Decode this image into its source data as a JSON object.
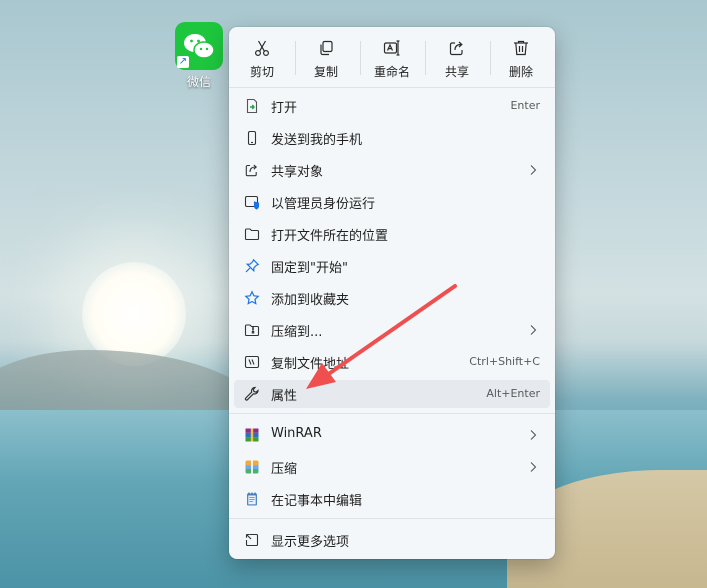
{
  "desktop": {
    "icon_label": "微信"
  },
  "toolbar": [
    {
      "label": "剪切",
      "icon": "cut-icon"
    },
    {
      "label": "复制",
      "icon": "copy-icon"
    },
    {
      "label": "重命名",
      "icon": "rename-icon"
    },
    {
      "label": "共享",
      "icon": "share-icon"
    },
    {
      "label": "删除",
      "icon": "delete-icon"
    }
  ],
  "items": [
    {
      "label": "打开",
      "shortcut": "Enter",
      "icon": "open-icon"
    },
    {
      "label": "发送到我的手机",
      "icon": "phone-icon"
    },
    {
      "label": "共享对象",
      "icon": "share-icon",
      "submenu": true
    },
    {
      "label": "以管理员身份运行",
      "icon": "admin-shield-icon"
    },
    {
      "label": "打开文件所在的位置",
      "icon": "folder-icon"
    },
    {
      "label": "固定到\"开始\"",
      "icon": "pin-icon"
    },
    {
      "label": "添加到收藏夹",
      "icon": "star-icon"
    },
    {
      "label": "压缩到...",
      "icon": "zip-folder-icon",
      "submenu": true
    },
    {
      "label": "复制文件地址",
      "shortcut": "Ctrl+Shift+C",
      "icon": "path-icon"
    },
    {
      "label": "属性",
      "shortcut": "Alt+Enter",
      "icon": "wrench-icon",
      "highlighted": true
    },
    {
      "label": "WinRAR",
      "icon": "winrar-icon",
      "submenu": true
    },
    {
      "label": "压缩",
      "icon": "compress-icon",
      "submenu": true
    },
    {
      "label": "在记事本中编辑",
      "icon": "notepad-icon"
    },
    {
      "label": "显示更多选项",
      "icon": "more-options-icon"
    }
  ],
  "colors": {
    "accent": "#1a73e8",
    "wechat": "#1dc63d",
    "arrow": "#ef4f4f",
    "menu_bg": "#f4f7f9"
  }
}
